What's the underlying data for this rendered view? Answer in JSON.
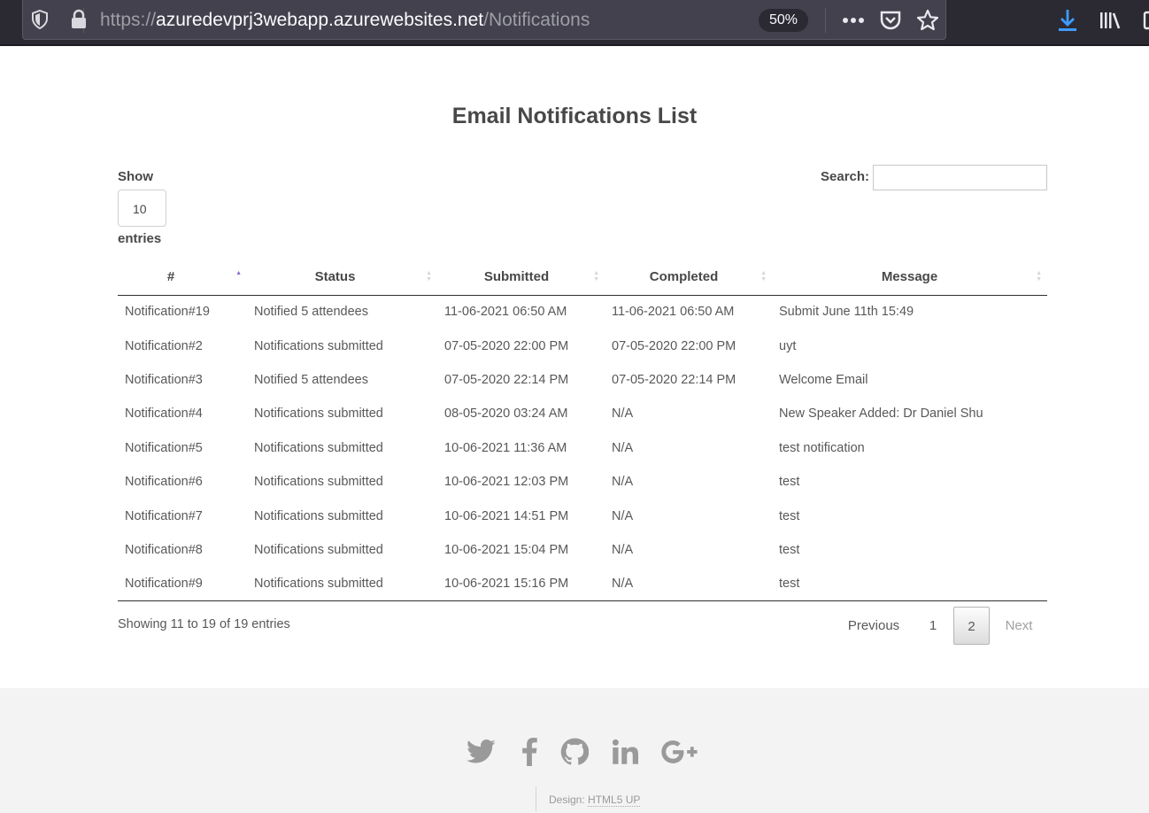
{
  "browser": {
    "url_scheme": "https://",
    "url_host": "azuredevprj3webapp.azurewebsites.net",
    "url_path": "/Notifications",
    "zoom": "50%"
  },
  "page": {
    "title": "Email Notifications List"
  },
  "controls": {
    "show_label": "Show",
    "page_length": "10",
    "entries_label": "entries",
    "search_label": "Search:",
    "search_value": ""
  },
  "table": {
    "columns": [
      "#",
      "Status",
      "Submitted",
      "Completed",
      "Message"
    ],
    "rows": [
      [
        "Notification#19",
        "Notified 5 attendees",
        "11-06-2021 06:50 AM",
        "11-06-2021 06:50 AM",
        "Submit June 11th 15:49"
      ],
      [
        "Notification#2",
        "Notifications submitted",
        "07-05-2020 22:00 PM",
        "07-05-2020 22:00 PM",
        "uyt"
      ],
      [
        "Notification#3",
        "Notified 5 attendees",
        "07-05-2020 22:14 PM",
        "07-05-2020 22:14 PM",
        "Welcome Email"
      ],
      [
        "Notification#4",
        "Notifications submitted",
        "08-05-2020 03:24 AM",
        "N/A",
        "New Speaker Added: Dr Daniel Shu"
      ],
      [
        "Notification#5",
        "Notifications submitted",
        "10-06-2021 11:36 AM",
        "N/A",
        "test notification"
      ],
      [
        "Notification#6",
        "Notifications submitted",
        "10-06-2021 12:03 PM",
        "N/A",
        "test"
      ],
      [
        "Notification#7",
        "Notifications submitted",
        "10-06-2021 14:51 PM",
        "N/A",
        "test"
      ],
      [
        "Notification#8",
        "Notifications submitted",
        "10-06-2021 15:04 PM",
        "N/A",
        "test"
      ],
      [
        "Notification#9",
        "Notifications submitted",
        "10-06-2021 15:16 PM",
        "N/A",
        "test"
      ]
    ]
  },
  "pagination": {
    "info": "Showing 11 to 19 of 19 entries",
    "previous": "Previous",
    "pages": [
      "1",
      "2"
    ],
    "current": "2",
    "next": "Next"
  },
  "footer": {
    "social_icons": [
      "twitter-icon",
      "facebook-icon",
      "github-icon",
      "linkedin-icon",
      "google-plus-icon"
    ],
    "credit_label": "Design:",
    "credit_link": "HTML5 UP"
  }
}
